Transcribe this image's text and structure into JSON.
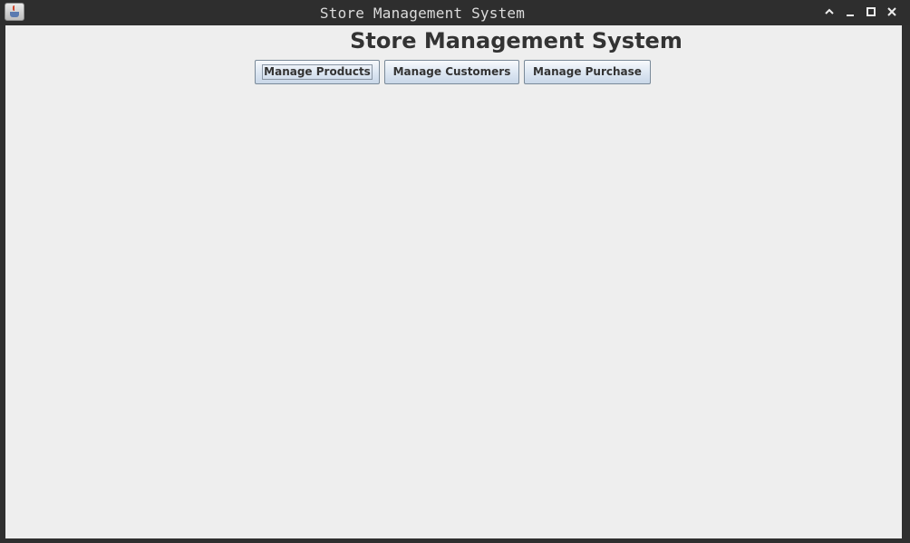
{
  "window": {
    "title": "Store Management System",
    "icon": "java-cup-icon",
    "controls": [
      "chevron-up-icon",
      "minimize-icon",
      "maximize-icon",
      "close-icon"
    ]
  },
  "main": {
    "heading": "Store Management System",
    "buttons": [
      {
        "label": "Manage Products",
        "focused": true
      },
      {
        "label": "Manage Customers",
        "focused": false
      },
      {
        "label": "Manage Purchase",
        "focused": false
      }
    ]
  },
  "colors": {
    "titlebar": "#2e2e2e",
    "content_background": "#eeeeee",
    "button_gradient_top": "#f7f9fc",
    "button_gradient_bottom": "#c9d7e8"
  }
}
